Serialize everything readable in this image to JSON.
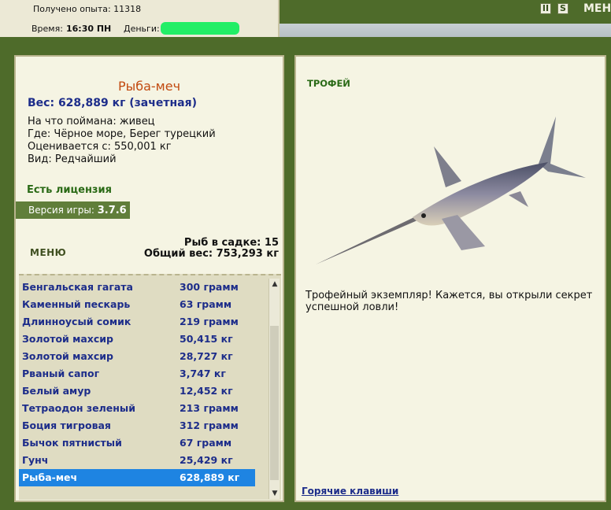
{
  "status": {
    "experience": "Получено опыта: 11318",
    "time_label": "Время:",
    "time_value": "16:30 ПН",
    "money_label": "Деньги:"
  },
  "toolbar": {
    "pause_label": "II",
    "sound_label": "S",
    "menu_label": "МЕНЮ"
  },
  "fish": {
    "name": "Рыба-меч",
    "weight": "Вес: 628,889 кг (зачетная)",
    "bait": "На что поймана: живец",
    "where": "Где: Чёрное море, Берег турецкий",
    "value": "Оценивается с: 550,001 кг",
    "kind": "Вид: Редчайший"
  },
  "license": "Есть лицензия",
  "version": {
    "label": "Версия игры: ",
    "number": "3.7.6"
  },
  "menu_button": "МЕНЮ",
  "cage": {
    "count": "Рыб в садке: 15",
    "total": "Общий вес: 753,293 кг"
  },
  "catch_list": [
    {
      "name": "Бенгальская гагата",
      "weight": "300 грамм"
    },
    {
      "name": "Каменный пескарь",
      "weight": "63 грамм"
    },
    {
      "name": "Длинноусый сомик",
      "weight": "219 грамм"
    },
    {
      "name": "Золотой махсир",
      "weight": "50,415 кг"
    },
    {
      "name": "Золотой махсир",
      "weight": "28,727 кг"
    },
    {
      "name": "Рваный сапог",
      "weight": "3,747 кг"
    },
    {
      "name": "Белый амур",
      "weight": "12,452 кг"
    },
    {
      "name": "Тетраодон зеленый",
      "weight": "213 грамм"
    },
    {
      "name": "Боция тигровая",
      "weight": "312 грамм"
    },
    {
      "name": "Бычок пятнистый",
      "weight": "67 грамм"
    },
    {
      "name": "Гунч",
      "weight": "25,429 кг"
    },
    {
      "name": "Рыба-меч",
      "weight": "628,889 кг"
    }
  ],
  "selected_index": 11,
  "trophy": {
    "label": "ТРОФЕЙ",
    "description": "Трофейный экземпляр! Кажется, вы открыли секрет успешной ловли!"
  },
  "hotkeys": "Горячие клавиши",
  "colors": {
    "frame_green": "#4e6b2a",
    "panel_bg": "#f5f4e3",
    "name_orange": "#c24a10",
    "text_blue": "#1d2d8a",
    "select_blue": "#1e84e2",
    "license_green": "#2a6a16"
  }
}
